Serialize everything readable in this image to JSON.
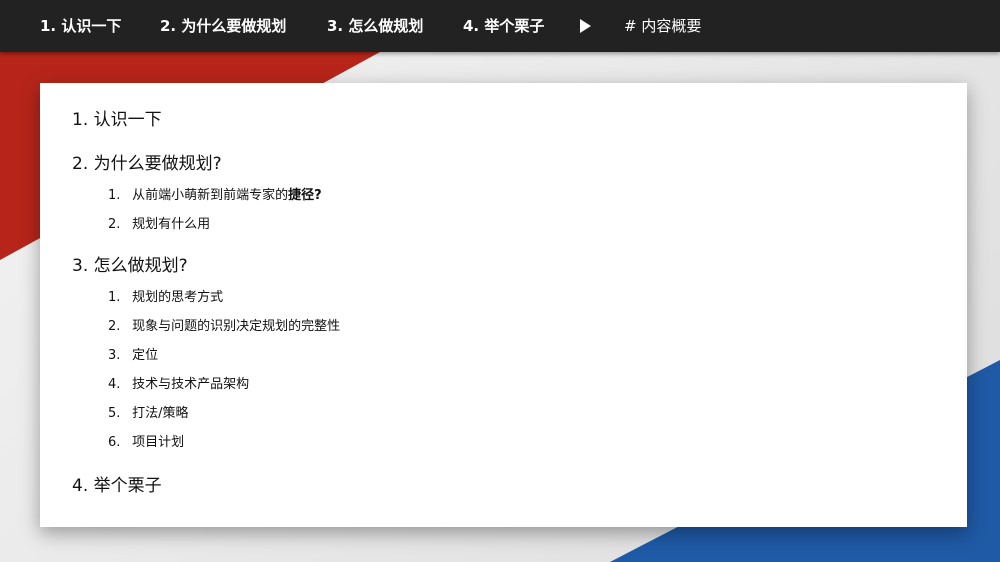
{
  "topbar": {
    "items": [
      {
        "label": "1. 认识一下"
      },
      {
        "label": "2. 为什么要做规划"
      },
      {
        "label": "3. 怎么做规划"
      },
      {
        "label": "4. 举个栗子"
      }
    ],
    "play_icon": "play-icon",
    "toc_label": "# 内容概要"
  },
  "outline": {
    "sections": [
      {
        "label": "1. 认识一下",
        "items": []
      },
      {
        "label": "2. 为什么要做规划?",
        "items": [
          {
            "num": "1.",
            "text": "从前端小萌新到前端专家的",
            "bold": "捷径?"
          },
          {
            "num": "2.",
            "text": "规划有什么用",
            "bold": ""
          }
        ]
      },
      {
        "label": "3. 怎么做规划?",
        "items": [
          {
            "num": "1.",
            "text": "规划的思考方式",
            "bold": ""
          },
          {
            "num": "2.",
            "text": "现象与问题的识别决定规划的完整性",
            "bold": ""
          },
          {
            "num": "3.",
            "text": "定位",
            "bold": ""
          },
          {
            "num": "4.",
            "text": "技术与技术产品架构",
            "bold": ""
          },
          {
            "num": "5.",
            "text": "打法/策略",
            "bold": ""
          },
          {
            "num": "6.",
            "text": "项目计划",
            "bold": ""
          }
        ]
      },
      {
        "label": "4. 举个栗子",
        "items": []
      }
    ]
  },
  "colors": {
    "topbar": "#222222",
    "accent_red": "#b7251a",
    "accent_blue": "#1f5aa6",
    "card": "#ffffff"
  }
}
